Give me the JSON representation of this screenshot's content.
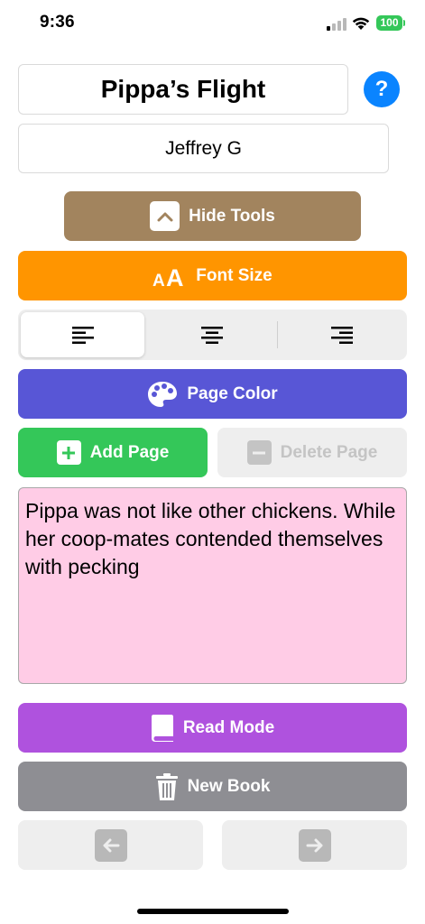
{
  "status_bar": {
    "time": "9:36",
    "battery_level": "100",
    "signal_bars_active": 1,
    "signal_bars_total": 4
  },
  "header": {
    "title": "Pippa’s Flight",
    "help_label": "?",
    "author": "Jeffrey G"
  },
  "toolbar": {
    "hide_tools_label": "Hide Tools",
    "font_size_label": "Font Size",
    "alignment_options": [
      "left",
      "center",
      "right"
    ],
    "selected_alignment": "left",
    "page_color_label": "Page Color",
    "add_page_label": "Add Page",
    "delete_page_label": "Delete Page"
  },
  "page": {
    "text": "Pippa was not like other chickens. While her coop-mates contended themselves with pecking",
    "background_color": "#ffcce6"
  },
  "actions": {
    "read_mode_label": "Read Mode",
    "new_book_label": "New Book"
  },
  "colors": {
    "hide_tools": "#a2845e",
    "font_size": "#ff9500",
    "page_color": "#5856d6",
    "add_page": "#34c759",
    "read_mode": "#af52de",
    "new_book": "#8e8e93",
    "help": "#0a84ff"
  },
  "icons": {
    "hide_tools": "chevron-up-icon",
    "font_size": "text-size-icon",
    "page_color": "palette-icon",
    "add_page": "plus-square-icon",
    "delete_page": "minus-square-icon",
    "read_mode": "book-icon",
    "new_book": "trash-icon",
    "prev": "arrow-left-icon",
    "next": "arrow-right-icon"
  }
}
